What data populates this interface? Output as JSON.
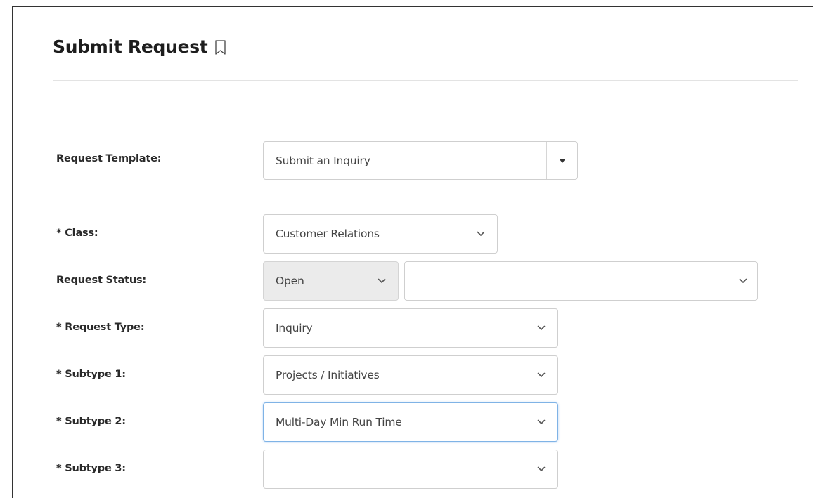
{
  "page": {
    "title": "Submit Request"
  },
  "fields": {
    "request_template": {
      "label": "Request Template:",
      "value": "Submit an Inquiry"
    },
    "class": {
      "label": "* Class:",
      "value": "Customer Relations"
    },
    "request_status": {
      "label": "Request Status:",
      "status_value": "Open",
      "secondary_value": ""
    },
    "request_type": {
      "label": "* Request Type:",
      "value": "Inquiry"
    },
    "subtype_1": {
      "label": "* Subtype 1:",
      "value": "Projects / Initiatives"
    },
    "subtype_2": {
      "label": "* Subtype 2:",
      "value": "Multi-Day Min Run Time"
    },
    "subtype_3": {
      "label": "* Subtype 3:",
      "value": ""
    }
  },
  "icons": {
    "title_icon": "bookmark-icon",
    "dropdown_icon": "chevron-down-icon",
    "template_dropdown_icon": "caret-down-icon"
  },
  "colors": {
    "focus_border": "#7fb3e6",
    "disabled_background": "#ebebeb",
    "border": "#cfcfcf"
  }
}
